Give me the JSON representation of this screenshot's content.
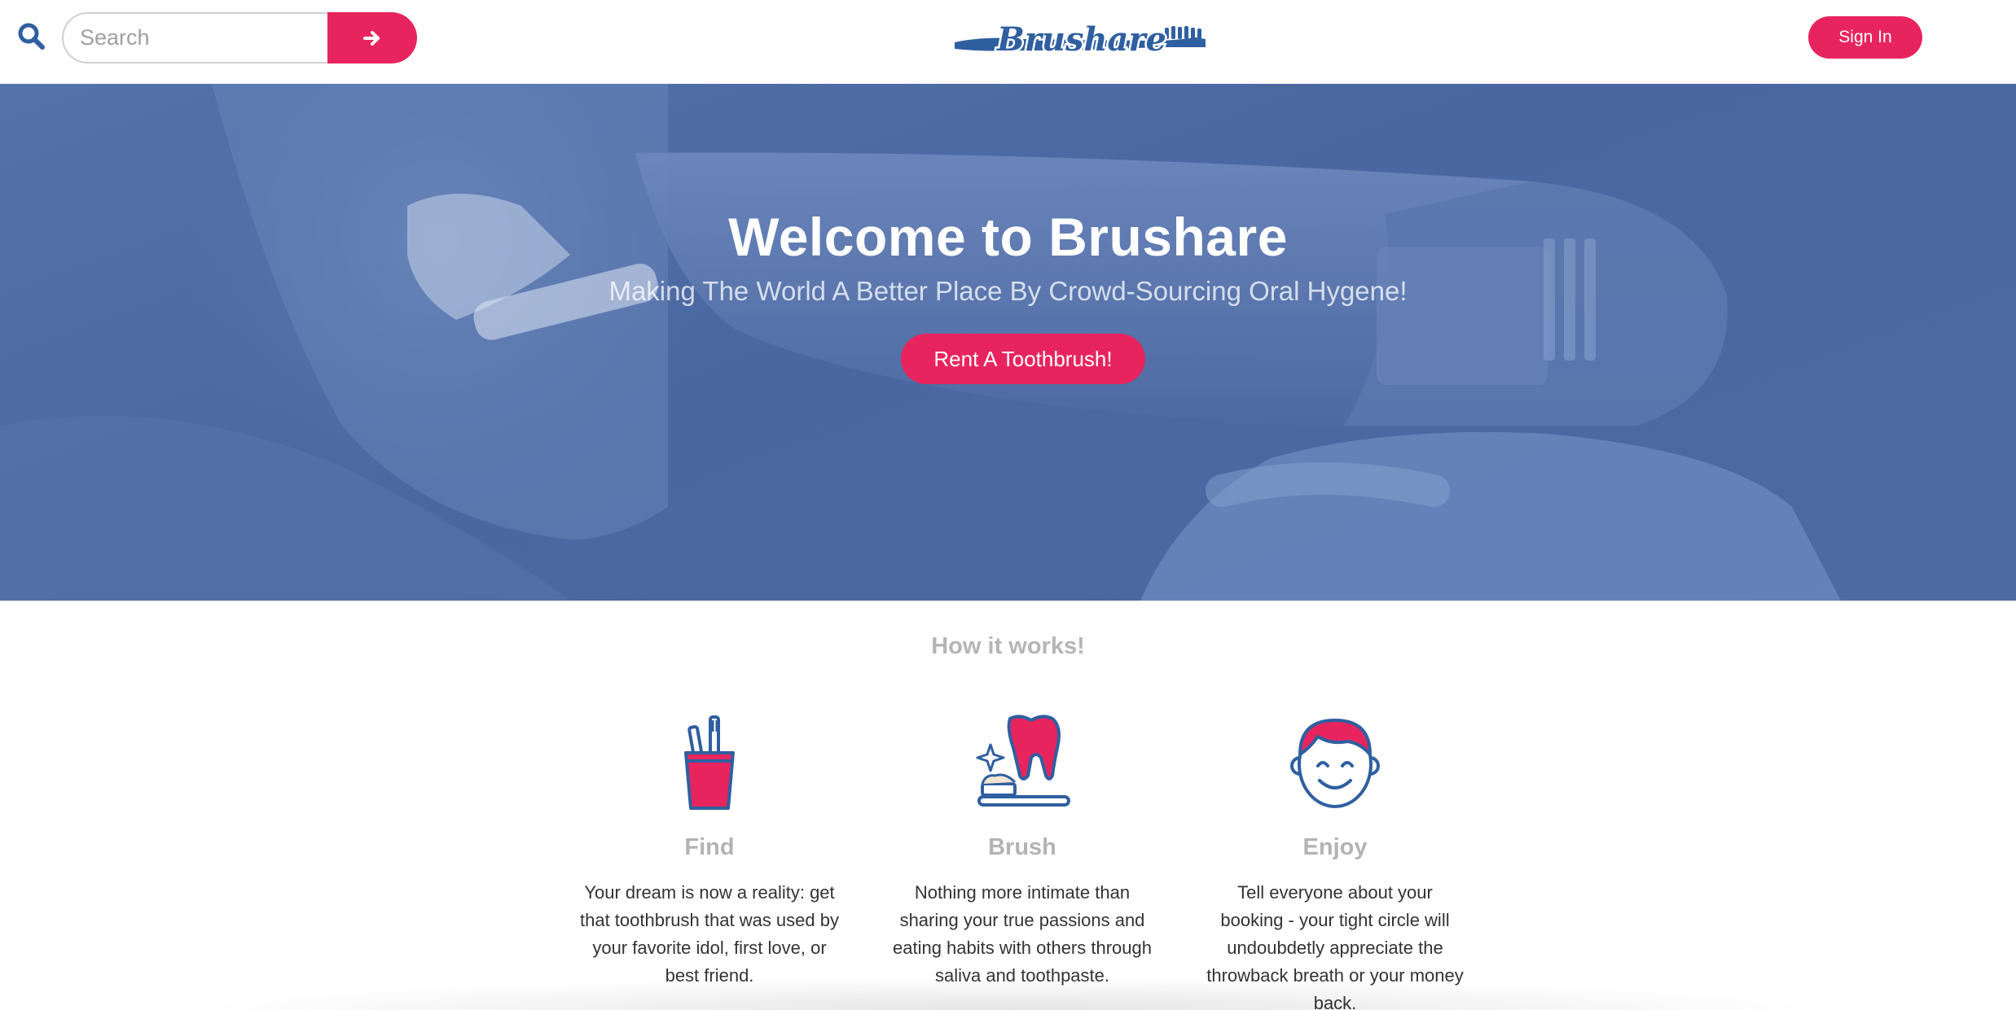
{
  "header": {
    "search": {
      "placeholder": "Search",
      "value": ""
    },
    "search_submit_icon": "arrow-right-icon",
    "logo_text": "Brushare",
    "signin_label": "Sign In"
  },
  "hero": {
    "title": "Welcome to Brushare",
    "subtitle": "Making The World A Better Place By Crowd-Sourcing Oral Hygene!",
    "cta_label": "Rent A Toothbrush!"
  },
  "how": {
    "title": "How it works!",
    "steps": [
      {
        "name": "Find",
        "icon": "toothbrush-cup-icon",
        "description": "Your dream is now a reality: get that toothbrush that was used by your favorite idol, first love, or best friend."
      },
      {
        "name": "Brush",
        "icon": "tooth-and-toothbrush-icon",
        "description": "Nothing more intimate than sharing your true passions and eating habits with others through saliva and toothpaste."
      },
      {
        "name": "Enjoy",
        "icon": "smiling-face-icon",
        "description": "Tell everyone about your booking - your tight circle will undoubdetly appreciate the throwback breath or your money back."
      }
    ]
  },
  "colors": {
    "accent": "#e8245e",
    "brand_blue": "#2f5fa0",
    "hero_overlay": "#4a67a1"
  }
}
